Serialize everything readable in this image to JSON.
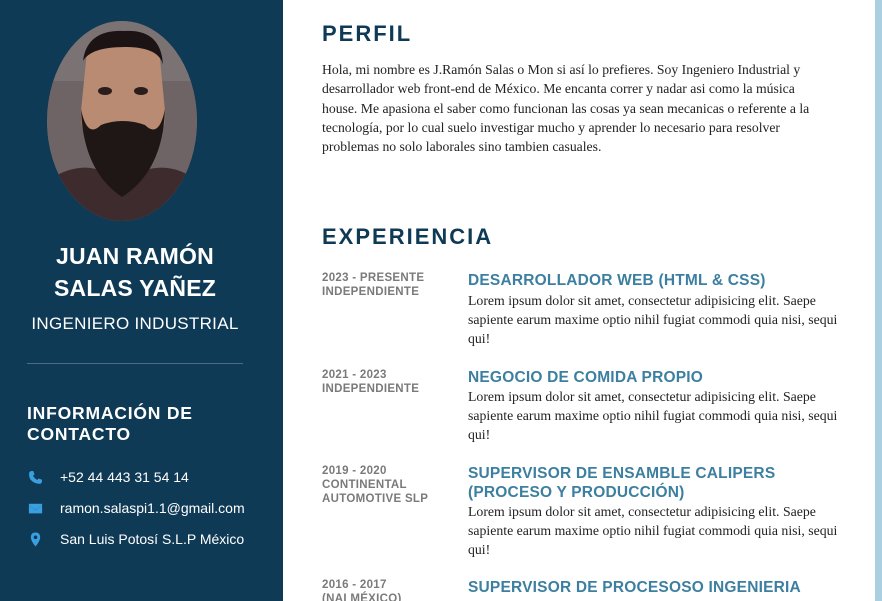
{
  "sidebar": {
    "name_line1": "JUAN RAMÓN",
    "name_line2": "SALAS YAÑEZ",
    "role": "INGENIERO INDUSTRIAL",
    "contact_title_line1": "INFORMACIÓN DE",
    "contact_title_line2": "CONTACTO",
    "contact": [
      {
        "icon": "phone-icon",
        "text": "+52 44 443 31 54 14"
      },
      {
        "icon": "email-icon",
        "text": "ramon.salaspi1.1@gmail.com"
      },
      {
        "icon": "location-icon",
        "text": "San Luis Potosí S.L.P México"
      }
    ]
  },
  "profile": {
    "title": "PERFIL",
    "text": "Hola, mi nombre es J.Ramón Salas o Mon si así lo prefieres. Soy Ingeniero Industrial y desarrollador web front-end de México. Me encanta correr y nadar asi como la música house. Me apasiona el saber como funcionan las cosas ya sean mecanicas o referente a la tecnología, por lo cual suelo investigar mucho y aprender lo necesario para resolver problemas no solo laborales sino tambien casuales."
  },
  "experience": {
    "title": "EXPERIENCIA",
    "items": [
      {
        "period": "2023 - PRESENTE",
        "company": "INDEPENDIENTE",
        "title": "DESARROLLADOR WEB (HTML & CSS)",
        "description": "Lorem ipsum dolor sit amet, consectetur adipisicing elit. Saepe sapiente earum maxime optio nihil fugiat commodi quia nisi, sequi qui!"
      },
      {
        "period": "2021 - 2023",
        "company": "INDEPENDIENTE",
        "title": "NEGOCIO DE COMIDA PROPIO",
        "description": "Lorem ipsum dolor sit amet, consectetur adipisicing elit. Saepe sapiente earum maxime optio nihil fugiat commodi quia nisi, sequi qui!"
      },
      {
        "period": "2019 - 2020",
        "company": "CONTINENTAL AUTOMOTIVE SLP",
        "title": "SUPERVISOR DE ENSAMBLE CALIPERS (PROCESO Y PRODUCCIÓN)",
        "description": "Lorem ipsum dolor sit amet, consectetur adipisicing elit. Saepe sapiente earum maxime optio nihil fugiat commodi quia nisi, sequi qui!"
      },
      {
        "period": "2016 - 2017",
        "company": "(NAI MÉXICO)",
        "title": "SUPERVISOR DE PROCESOSO INGENIERIA",
        "description": ""
      }
    ]
  },
  "colors": {
    "sidebar_bg": "#0f3a56",
    "accent_heading": "#0f3a56",
    "job_title": "#3c7fa0",
    "contact_icon": "#3a9fe0",
    "right_edge": "#a9cfe0"
  }
}
